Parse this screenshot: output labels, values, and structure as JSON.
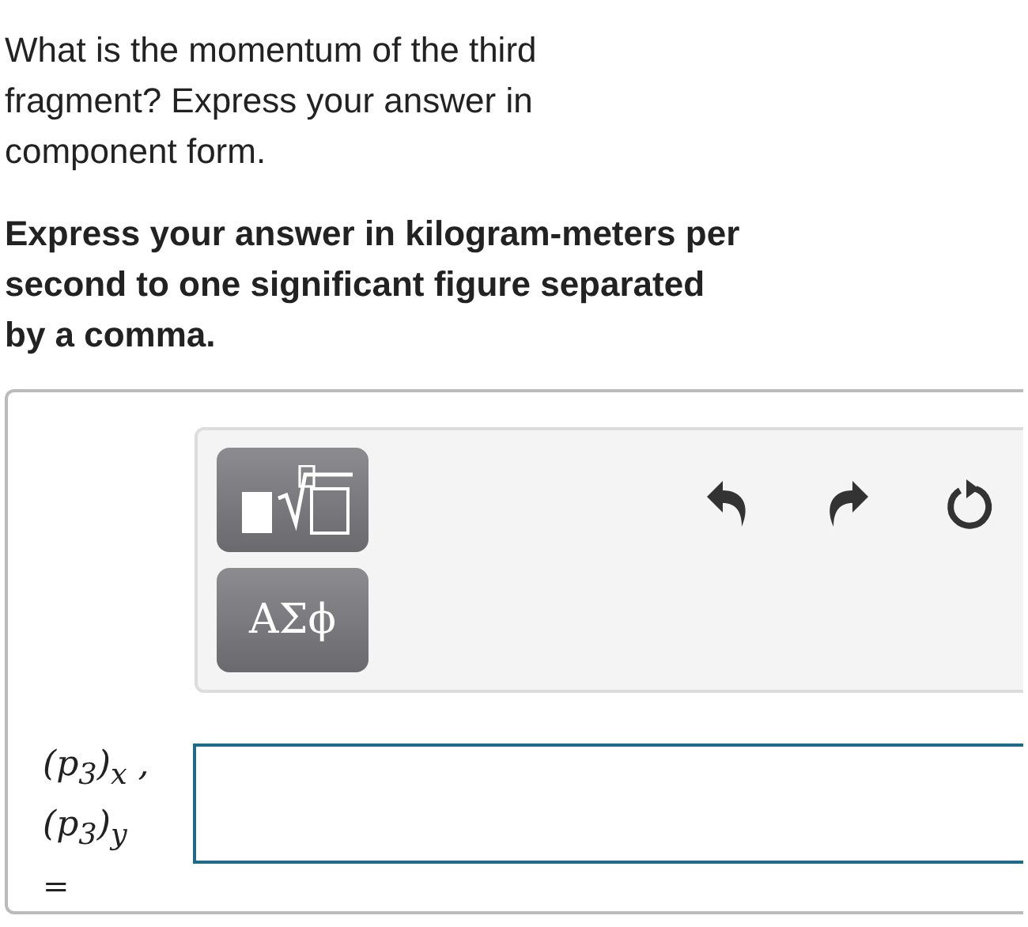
{
  "question": "What is the momentum of the third fragment? Express your answer in component form.",
  "instruction": "Express your answer in kilogram-meters per second to one significant figure separated by a comma.",
  "toolbar": {
    "greek_button": "ΑΣϕ"
  },
  "answer": {
    "label_lines": [
      "(p$_{3}$)$_{x}$ ,",
      "(p$_{3}$)$_{y}$",
      "="
    ]
  }
}
